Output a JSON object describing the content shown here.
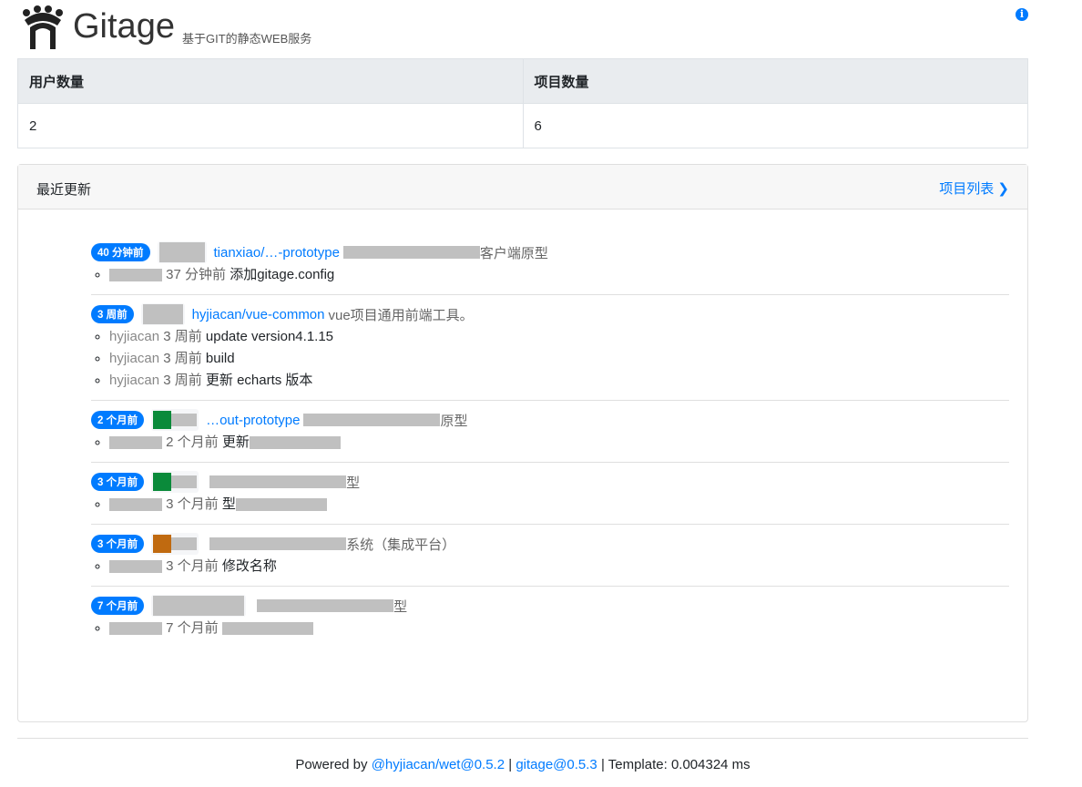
{
  "header": {
    "brand": "Gitage",
    "subtitle": "基于GIT的静态WEB服务",
    "info_icon": "info-circle-icon"
  },
  "stats": {
    "headers": [
      "用户数量",
      "项目数量"
    ],
    "values": [
      "2",
      "6"
    ]
  },
  "recent": {
    "title": "最近更新",
    "link": "项目列表",
    "items": [
      {
        "badge": "40 分钟前",
        "project": "tianxiao/…-prototype",
        "desc": "客户端原型",
        "commits": [
          {
            "author": "",
            "time": "37 分钟前",
            "msg": "添加gitage.config"
          }
        ]
      },
      {
        "badge": "3 周前",
        "project": "hyjiacan/vue-common",
        "desc": "vue项目通用前端工具。",
        "commits": [
          {
            "author": "hyjiacan",
            "time": "3 周前",
            "msg": "update version4.1.15"
          },
          {
            "author": "hyjiacan",
            "time": "3 周前",
            "msg": "build"
          },
          {
            "author": "hyjiacan",
            "time": "3 周前",
            "msg": "更新 echarts 版本"
          }
        ]
      },
      {
        "badge": "2 个月前",
        "project": "…out-prototype",
        "desc": "原型",
        "commits": [
          {
            "author": "",
            "time": "2 个月前",
            "msg": "更新"
          }
        ]
      },
      {
        "badge": "3 个月前",
        "project": "",
        "desc": "型",
        "commits": [
          {
            "author": "",
            "time": "3 个月前",
            "msg": "型"
          }
        ]
      },
      {
        "badge": "3 个月前",
        "project": "",
        "desc": "系统（集成平台）",
        "commits": [
          {
            "author": "",
            "time": "3 个月前",
            "msg": "修改名称"
          }
        ]
      },
      {
        "badge": "7 个月前",
        "project": "",
        "desc": "型",
        "commits": [
          {
            "author": "",
            "time": "7 个月前",
            "msg": ""
          }
        ]
      }
    ]
  },
  "footer": {
    "prefix": "Powered by ",
    "wet": "@hyjiacan/wet@0.5.2",
    "sep": " | ",
    "gitage": "gitage@0.5.3",
    "template": " | Template: 0.004324 ms"
  }
}
